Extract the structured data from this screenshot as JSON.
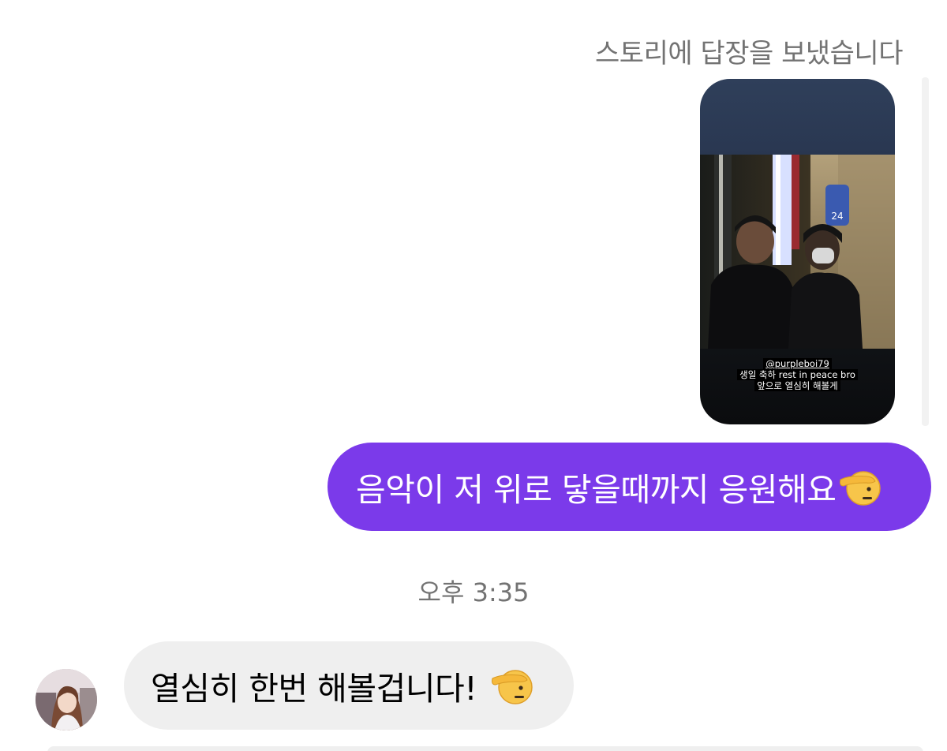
{
  "thread": {
    "story_reply_note": "스토리에 답장을 보냈습니다",
    "story": {
      "caption_mention": "@purpleboi79",
      "caption_line2": "생일 축하 rest in peace bro",
      "caption_line3": "앞으로 열심히 해볼게"
    },
    "outgoing_message": "음악이 저 위로 닿을때까지 응원해요",
    "timestamp": "오후 3:35",
    "incoming_message": "열심히 한번 해볼겁니다!"
  },
  "icons": {
    "emoji": "saluting-face-icon",
    "avatar": "user-avatar"
  },
  "colors": {
    "outgoing_bubble": "#7b3aea",
    "incoming_bubble": "#efefef",
    "meta_text": "#737373"
  }
}
